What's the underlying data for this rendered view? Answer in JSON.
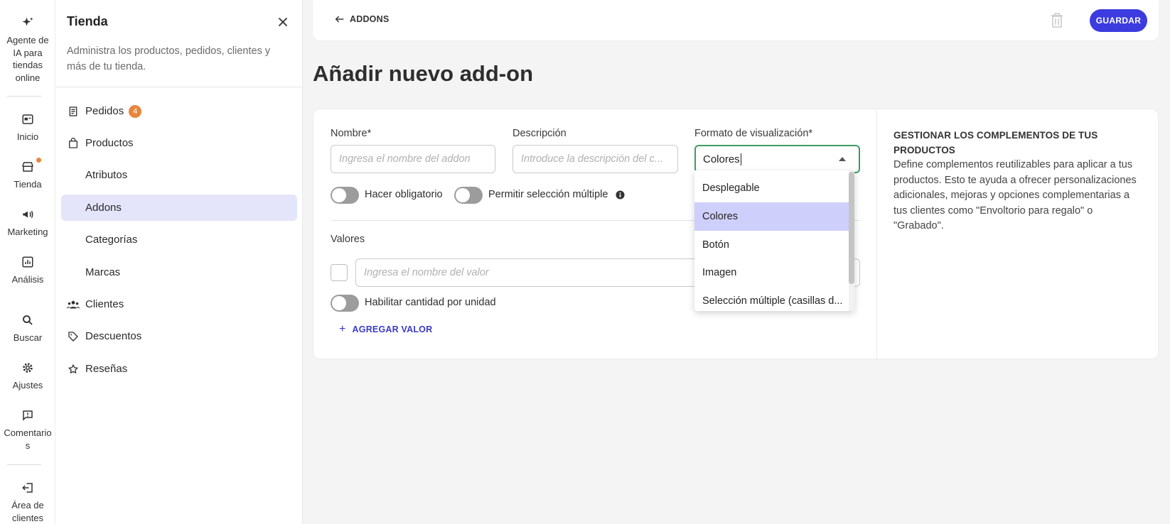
{
  "rail": {
    "items": [
      {
        "label": "Agente de IA para tiendas online",
        "icon": "sparkles-icon"
      },
      {
        "label": "Inicio",
        "icon": "home-icon"
      },
      {
        "label": "Tienda",
        "icon": "store-icon"
      },
      {
        "label": "Marketing",
        "icon": "megaphone-icon"
      },
      {
        "label": "Análisis",
        "icon": "chart-icon"
      },
      {
        "label": "Buscar",
        "icon": "search-icon"
      },
      {
        "label": "Ajustes",
        "icon": "gear-icon"
      },
      {
        "label": "Comentarios",
        "icon": "feedback-icon"
      },
      {
        "label": "Área de clientes",
        "icon": "logout-icon"
      }
    ],
    "accent": "#e8853d"
  },
  "panel": {
    "title": "Tienda",
    "description": "Administra los productos, pedidos, clientes y más de tu tienda.",
    "nav": [
      {
        "label": "Pedidos",
        "badge": "4",
        "icon": "receipt-icon"
      },
      {
        "label": "Productos",
        "icon": "bag-icon"
      },
      {
        "label": "Atributos"
      },
      {
        "label": "Addons",
        "active": true
      },
      {
        "label": "Categorías"
      },
      {
        "label": "Marcas"
      },
      {
        "label": "Clientes",
        "icon": "users-icon"
      },
      {
        "label": "Descuentos",
        "icon": "tag-icon"
      },
      {
        "label": "Reseñas",
        "icon": "star-icon"
      }
    ]
  },
  "topbar": {
    "back_label": "ADDONS",
    "save_label": "GUARDAR"
  },
  "page_title": "Añadir nuevo add-on",
  "form": {
    "name_label": "Nombre*",
    "name_placeholder": "Ingresa el nombre del addon",
    "desc_label": "Descripción",
    "desc_placeholder": "Introduce la descripción del c...",
    "format_label": "Formato de visualización*",
    "format_value": "Colores",
    "toggle_required": "Hacer obligatorio",
    "toggle_multiple": "Permitir selección múltiple",
    "values_label": "Valores",
    "value_placeholder": "Ingresa el nombre del valor",
    "toggle_quantity": "Habilitar cantidad por unidad",
    "add_value_label": "AGREGAR VALOR"
  },
  "dropdown": {
    "options": [
      "Desplegable",
      "Colores",
      "Botón",
      "Imagen",
      "Selección múltiple (casillas d..."
    ],
    "selected": "Colores"
  },
  "help": {
    "title": "GESTIONAR LOS COMPLEMENTOS DE TUS PRODUCTOS",
    "body": "Define complementos reutilizables para aplicar a tus productos. Esto te ayuda a ofrecer personalizaciones adicionales, mejoras y opciones complementarias a tus clientes como \"Envoltorio para regalo\" o \"Grabado\"."
  },
  "colors": {
    "primary": "#3b3be0",
    "active_nav": "#e4e4fa",
    "selected_option": "#cfcffb",
    "focus_border": "#3d9b60"
  }
}
